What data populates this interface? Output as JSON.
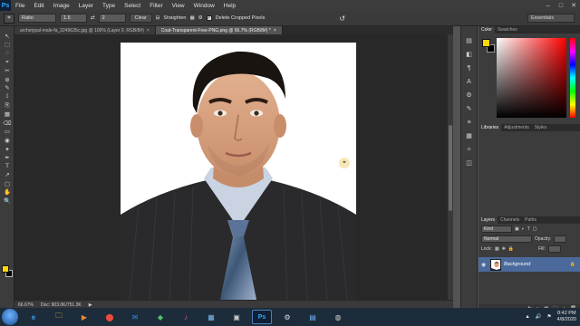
{
  "app": {
    "logo": "Ps"
  },
  "menu": [
    "File",
    "Edit",
    "Image",
    "Layer",
    "Type",
    "Select",
    "Filter",
    "View",
    "Window",
    "Help"
  ],
  "window_controls": [
    "–",
    "□",
    "✕"
  ],
  "options": {
    "ratio_value": "Ratio",
    "width_value": "1.5",
    "swap_icon": "⇄",
    "height_value": "2",
    "clear_label": "Clear",
    "straighten_label": "Straighten",
    "delete_cropped_label": "Delete Cropped Pixels",
    "delete_cropped_checked": "✓",
    "reset_icon": "↺",
    "workspace": "Essentials"
  },
  "tabs": [
    {
      "label": "archetypal-male-fa_3249635c.jpg @ 100% (Layer 0, RGB/8#)",
      "close": "×"
    },
    {
      "label": "Coat-Transparent-Free-PNG.png @ 66.7% (RGB/8#) *",
      "close": "×"
    }
  ],
  "status": {
    "zoom": "66.67%",
    "doc": "Doc: 903.0K/751.3K",
    "arrow": "▶"
  },
  "tools": [
    "↖",
    "⬚",
    "◌",
    "⌖",
    "✂",
    "⊕",
    "✎",
    "⟟",
    "⎘",
    "▦",
    "⌫",
    "▭",
    "◉",
    "✦",
    "✒",
    "T",
    "↗",
    "▢",
    "✋",
    "🔍"
  ],
  "mid_icons": [
    "▤",
    "◧",
    "¶",
    "A",
    "⚙",
    "✎",
    "≡",
    "▦",
    "✧",
    "◫"
  ],
  "panels": {
    "color_tabs": [
      "Color",
      "Swatches"
    ],
    "library_tabs": [
      "Libraries",
      "Adjustments",
      "Styles"
    ],
    "layer_tabs": [
      "Layers",
      "Channels",
      "Paths"
    ],
    "kind_label": "Kind",
    "blend_mode": "Normal",
    "opacity_label": "Opacity:",
    "fill_label": "Fill:",
    "lock_label": "Lock:",
    "layer_name": "Background",
    "layer_lock_icon": "🔒",
    "layer_bottom_icons": [
      "fx",
      "◐",
      "▣",
      "🗀",
      "+",
      "🗑"
    ]
  },
  "taskbar": {
    "apps": [
      "e",
      "🗀",
      "▶",
      "⬤",
      "✉",
      "◆",
      "♪",
      "▦",
      "▣",
      "Ps",
      "⚙",
      "▤",
      "◍"
    ],
    "time": "8:42 PM",
    "date": "4/8/2020",
    "tray_icons": [
      "▲",
      "🔊",
      "⚑"
    ]
  }
}
